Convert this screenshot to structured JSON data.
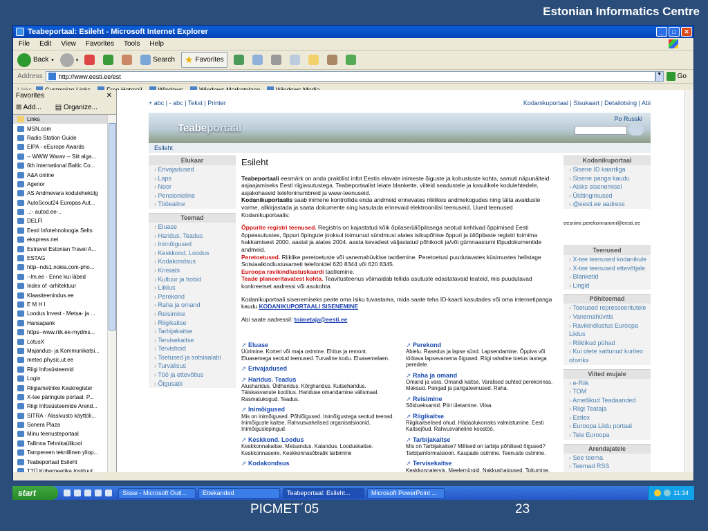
{
  "slide": {
    "header": "Estonian Informatics Centre",
    "footer_left": "PICMET´05",
    "page_number": "23"
  },
  "window": {
    "title": "Teabeportaal: Esileht - Microsoft Internet Explorer"
  },
  "menu": [
    "File",
    "Edit",
    "View",
    "Favorites",
    "Tools",
    "Help"
  ],
  "toolbar": {
    "back": "Back",
    "search": "Search",
    "favorites": "Favorites"
  },
  "address": {
    "label": "Address",
    "url": "http://www.eesti.ee/est",
    "go": "Go"
  },
  "links": {
    "label": "Links",
    "items": [
      "Customize Links",
      "Free Hotmail",
      "Windows",
      "Windows Marketplace",
      "Windows Media"
    ]
  },
  "favorites": {
    "title": "Favorites",
    "add": "Add...",
    "organize": "Organize...",
    "items": [
      "Links",
      "MSN.com",
      "Radio Station Guide",
      "EIPA - eEurope Awards",
      "-- WWW Warav -- Siit alga...",
      "6th International Baltic Co...",
      "A&A online",
      "Agenor",
      "AS Andmevara  kodulehekülg",
      "AutoScout24 Europas Aut...",
      "..:- autod.ee-..",
      "DELFI",
      "Eesti Infotehnoloogia Selts",
      "ekspress.net",
      "Estravel  Estonian Travel A...",
      "ESTAG",
      "http--nds1.nokia.com-pho...",
      "--lm.ee - Enne kui läbed",
      "Index of -arhitektuur",
      "Klaasiteenindus.ee",
      "E M H I",
      "Loodus Invest - Metsa- ja ...",
      "Hansapank",
      "https--www.riik.ee-mydms...",
      "LotusX",
      "Majandus- ja Kommunikatsi...",
      "meteo.physic.ut.ee",
      "Riigi Infosüsteemid",
      "Login",
      "Riigiametnike Keskregister",
      "X-tee päringute portaal. P...",
      "Riigi Infosüsteemide Arend...",
      "SITRA - Alasivusto käyttöli...",
      "Sonera Plaza",
      "Minu teenusteportaal",
      "Tallinna Tehnikaülikool",
      "Tampereen teknillinen yliop...",
      "Teabeportaal Esileht",
      "TTÜ Küberneetika Instituut"
    ]
  },
  "site": {
    "top_left": [
      "+ abc",
      "- abc",
      "Tekst",
      "Printer"
    ],
    "top_right": [
      "Kodanikuportaal",
      "Sisukaart",
      "Detailotsing",
      "Abi"
    ],
    "logo_a": "Teabe",
    "logo_b": "portaal",
    "russian": "Po Russki",
    "breadcrumb": "Esileht",
    "left": [
      {
        "title": "Elukaar",
        "items": [
          "Erivajadused",
          "Laps",
          "Noor",
          "Pensionieline",
          "Tööealine"
        ]
      },
      {
        "title": "Teemad",
        "items": [
          "Eluase",
          "Haridus. Teadus",
          "Inimõigused",
          "Keskkond. Loodus",
          "Kodakondsus",
          "Kriisiabi",
          "Kultuur ja hobid",
          "Liiklus",
          "Perekond",
          "Raha ja omand",
          "Reisimine",
          "Riigikaitse",
          "Tarbijakaitse",
          "Tervisekaitse",
          "Tervishoid",
          "Toetused ja sotsiaalabi",
          "Turvalisus",
          "Töö ja ettevõtlus",
          "Õigusabi"
        ]
      }
    ],
    "main": {
      "title": "Esileht",
      "p1_b1": "Teabeportaali",
      "p1_t1": " eesmärk on anda praktilist infot Eestis elavate inimeste õiguste ja kohustuste kohta, samuti näpunäiteid asjaajamiseks Eesti riigiasutustega. Teabeportaalist leiate blankette, viiteid seadustele ja kasulikele kodulehtedele, asjakohaseid telefoninumbreid ja www-teenuseid.",
      "p1_b2": "Kodanikuportaalis",
      "p1_t2": " saab inimene kontrollida enda andmeid erinevates riiklikes andmekogudes ning täita avalduste vorme, allkirjastada ja saata dokumente ning kasutada erinevaid elektroonilisi teenuseid. Uued teenused Kodanikuportaalis:",
      "p2_r1": "Õppurite registri teenused.",
      "p2_t1": " Registris on kajastatud kõik õpilase/üliõpilasega seotud kehtivad õppimised Eesti õppeasutustes, õppuri õpingute jooksul toimunud sündmusi alates isikupõhise õppuri ja üliõpilaste registri toimima hakkamisest 2000. aastal ja alates 2004. aasta kevadest väljastatud põhikooli ja/või gümnaasiumi lõpudokumentide andmeid.",
      "p2_r2": "Peretoetused.",
      "p2_t2": " Riiklike peretoetuste või vanemahüvitise taotlemine. Peretoetusi puudutavates küsimustes helistage Sotsiaalkindlustusameti telefonidel 620 8344 või 620 8345.",
      "p2_r3": "Euroopa ravikindlustuskaardi",
      "p2_t3": " taotlemine.",
      "p2_r4": "Teade planeeritavatest kohta.",
      "p2_t4": " Teavitusteenus võimaldab tellida asutuste edastatavaid teateid, mis puudutavad konkreetset aadressi või asukohta.",
      "p3": "Kodanikuportaali sisenemiseks peate oma isiku tuvastama, mida saate teha ID-kaarti kasutades või oma internetipanga kaudu ",
      "p3_link": "KODANIKUPORTAALI SISENEMINE",
      "p4": "Abi saate aadressil: ",
      "p4_link": "toimetaja@eesti.ee"
    },
    "subl": [
      {
        "h": "Eluase",
        "t": "Üürimine. Korteri või maja ostmine. Ehitus ja remont. Eluasemega seotud teenused. Turvaline kodu. Eluasemelaen."
      },
      {
        "h": "Erivajadused",
        "t": ""
      },
      {
        "h": "Haridus. Teadus",
        "t": "Alusharidus. Üldharidus. Kõrgharidus. Kutseharidus. Täiskasvanute koolitus. Hariduse omandamine välismaal. Rasmatukogud. Teadus."
      },
      {
        "h": "Inimõigused",
        "t": "Mis on inimõigused. Põhiõigused. Inimõigustega seotud teenad. Inimõiguste kaitse. Rahvusvahelised organisatsioonid. Inimõiguslepingud."
      },
      {
        "h": "Keskkond. Loodus",
        "t": "Keskkonnakaitse. Metsandus. Kalandus. Looduskaitse. Keskkonnaseire. Keskkonnasõbralik tarbimine"
      },
      {
        "h": "Kodakondsus",
        "t": ""
      }
    ],
    "subr": [
      {
        "h": "Perekond",
        "t": "Abielu. Rasedus ja lapse sünd. Lapsendamine. Õppiva või töötava lapsevanema õigused. Riigi rahaline toetus lastega peredele."
      },
      {
        "h": "Raha ja omand",
        "t": "Omand ja vara. Omandi kaitse. Varalised suhted perekonnas. Maksud. Pangad ja pangateenused. Raha."
      },
      {
        "h": "Reisimine",
        "t": "Sõidueksamid. Piiri ületamine. Viisa."
      },
      {
        "h": "Riigikaitse",
        "t": "Riigikaitselised ohud. Hädaolukorraks valmistumine. Eesti Kaitsejõud. Rahvusvaheline koostöö."
      },
      {
        "h": "Tarbijakaitse",
        "t": "Mis on Tarbijakaitse? Millised on tarbija põhilised õigused? Tarbijainformatsioon. Kaupade ostmine. Teenuste ostmine."
      },
      {
        "h": "Tervisekaitse",
        "t": "Keskkonnatervis. Meelemürgid. Nakkushaigused. Toitumine."
      }
    ],
    "right": {
      "b1": {
        "title": "Kodanikuportaal",
        "items": [
          "Sisene ID kaardiga",
          "Sisene panga kaudu",
          "Abiks sisenemisel",
          "Üldtingimused",
          "@eesti.ee aadress"
        ]
      },
      "email": "eesnimi.perekonnanimi@eesti.ee",
      "b2": [
        {
          "title": "Teenused",
          "items": [
            "X-tee teenused kodanikule",
            "X-tee teenused ettevõtjale",
            "Blanketid",
            "Lingid"
          ]
        },
        {
          "title": "Põhiteemad",
          "items": [
            "Toetused represseeritutele",
            "Vanemahüvitis",
            "Ravikindlustus Euroopa Liidus",
            "Riiklikud pühad",
            "Kui olete sattunud kuriteo ohvriks"
          ]
        },
        {
          "title": "Viited mujale",
          "items": [
            "e-Riik",
            "TOM",
            "Ametlikud Teadaanded",
            "Riigi Teataja",
            "Estlex",
            "Euroopa Liidu portaal",
            "Teie Euroopa"
          ]
        },
        {
          "title": "Arendajatele",
          "items": [
            "See teema",
            "Teemad RSS",
            "Teemad RDF",
            "Lingid RSS"
          ]
        }
      ]
    }
  },
  "taskbar": {
    "start": "start",
    "tasks": [
      "Sisse - Microsoft Outl...",
      "Ettekanded",
      "Teabeportaal: Esileht...",
      "Microsoft PowerPoint ..."
    ],
    "clock": "11:34"
  }
}
